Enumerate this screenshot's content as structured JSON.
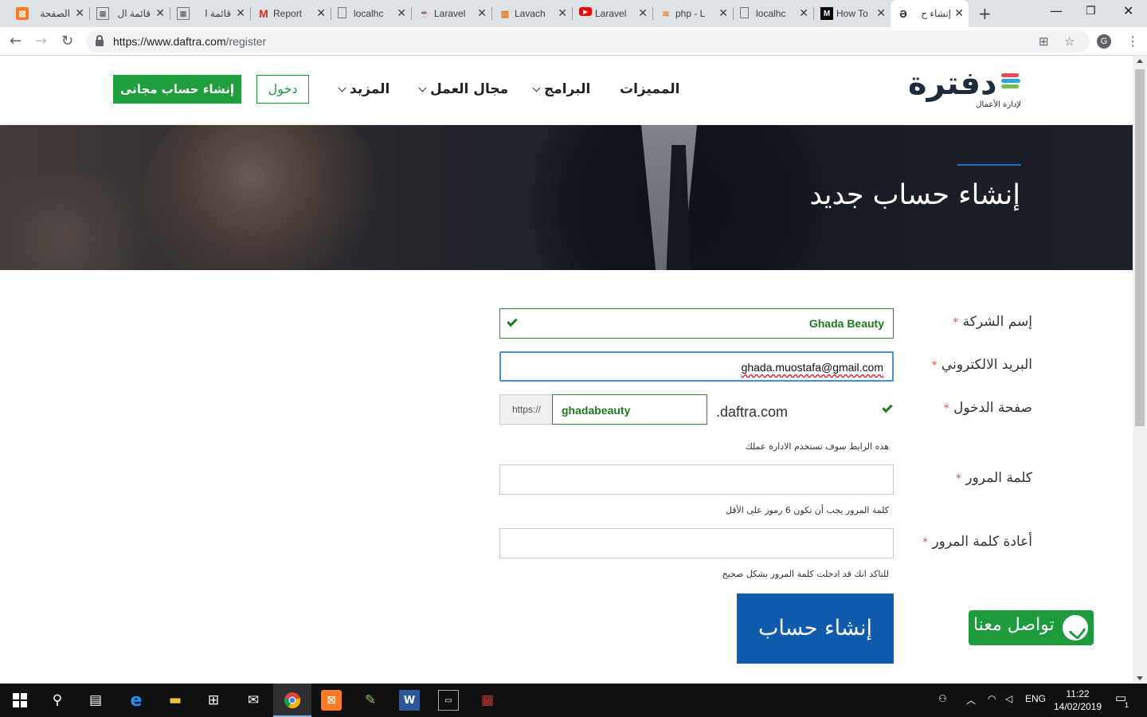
{
  "browser": {
    "tabs": [
      {
        "label": "الصفحة",
        "icon": "xampp-icon"
      },
      {
        "label": "قائمة ال",
        "icon": "calendar-icon"
      },
      {
        "label": "قائمة ا",
        "icon": "calendar-icon"
      },
      {
        "label": "Report",
        "icon": "gmail-icon"
      },
      {
        "label": "localhc",
        "icon": "page-icon"
      },
      {
        "label": "Laravel",
        "icon": "laravel-icon"
      },
      {
        "label": "Lavach",
        "icon": "chart-icon"
      },
      {
        "label": "Laravel",
        "icon": "youtube-icon"
      },
      {
        "label": "php - L",
        "icon": "stackoverflow-icon"
      },
      {
        "label": "localhc",
        "icon": "page-icon"
      },
      {
        "label": "How To",
        "icon": "medium-icon"
      },
      {
        "label": "إنشاء ح",
        "icon": "daftra-icon"
      }
    ],
    "url_host": "https://www.daftra.com",
    "url_path": "/register",
    "profile_initial": "G"
  },
  "header": {
    "logo_text": "دفترة",
    "logo_tagline": "لإدارة الأعمال",
    "nav": {
      "features": "المميزات",
      "programs": "البرامج",
      "business": "مجال العمل",
      "more": "المزيد"
    },
    "login_label": "دخول",
    "signup_label": "إنشاء حساب مجانى"
  },
  "hero": {
    "title": "إنشاء حساب جديد"
  },
  "form": {
    "company_label": "إسم الشركة",
    "company_value": "Ghada Beauty",
    "email_label": "البريد الالكتروني",
    "email_value": "ghada.muostafa@gmail.com",
    "login_page_label": "صفحة الدخول",
    "subdomain_prefix": "https://",
    "subdomain_value": "ghadabeauty",
    "domain_suffix": ".daftra.com",
    "login_page_hint": "هذه الرابط سوف تستخدم الادارة عملك",
    "password_label": "كلمة المرور",
    "password_hint": "كلمة المرور يجب أن تكون 6 رموز على الأقل",
    "confirm_label": "أعادة كلمة المرور",
    "confirm_hint": "للتاكد انك قد ادخلت كلمة المرور بشكل صحيح",
    "required_mark": "*",
    "submit_label": "إنشاء حساب"
  },
  "whatsapp": {
    "label": "تواصل معنا"
  },
  "taskbar": {
    "lang": "ENG",
    "time": "11:22",
    "date": "14/02/2019",
    "notifications": "1"
  },
  "colors": {
    "brand_green": "#1f9e3c",
    "submit_blue": "#0f5cad",
    "valid_green": "#1e7a1e",
    "required_red": "#d9534f"
  }
}
